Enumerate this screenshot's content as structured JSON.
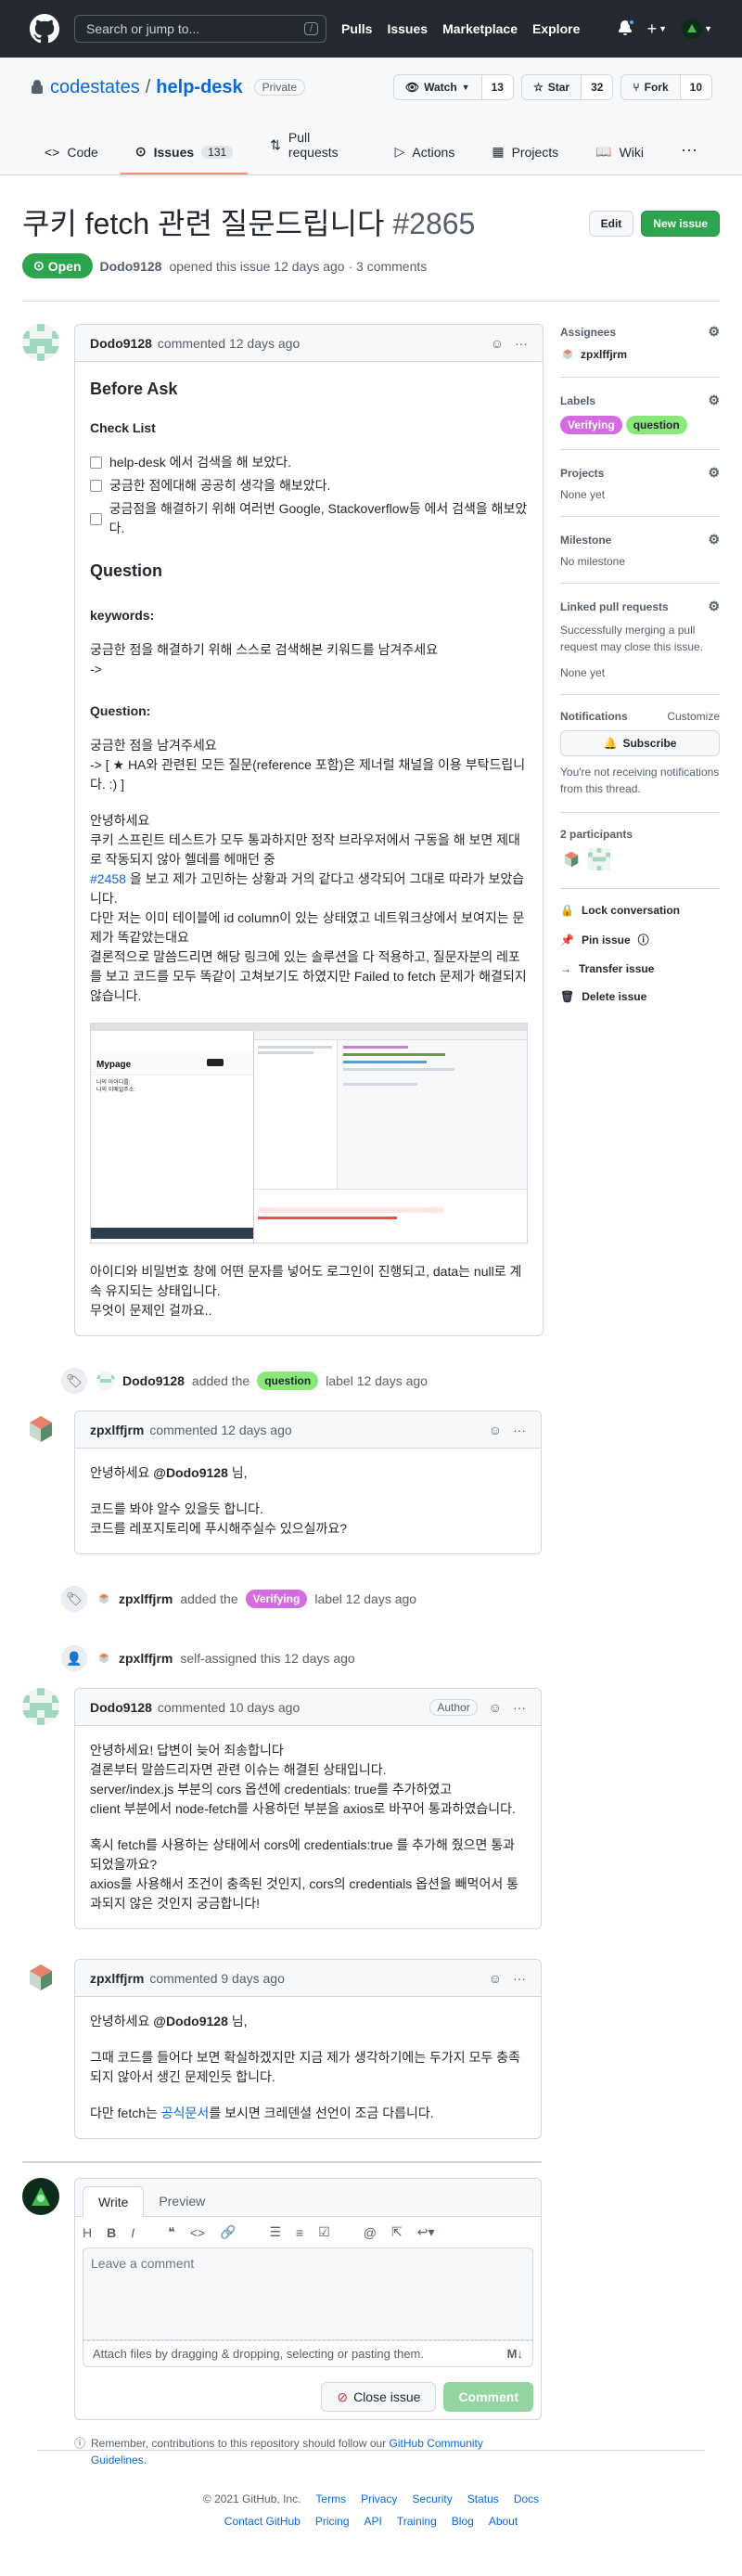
{
  "header": {
    "search_placeholder": "Search or jump to...",
    "search_shortcut": "/",
    "nav": [
      "Pulls",
      "Issues",
      "Marketplace",
      "Explore"
    ]
  },
  "repo": {
    "owner": "codestates",
    "separator": "/",
    "name": "help-desk",
    "visibility": "Private",
    "watch_label": "Watch",
    "watch_count": "13",
    "star_label": "Star",
    "star_count": "32",
    "fork_label": "Fork",
    "fork_count": "10",
    "tabs": [
      {
        "label": "Code"
      },
      {
        "label": "Issues",
        "count": "131"
      },
      {
        "label": "Pull requests"
      },
      {
        "label": "Actions"
      },
      {
        "label": "Projects"
      },
      {
        "label": "Wiki"
      }
    ]
  },
  "issue": {
    "title": "쿠키 fetch 관련 질문드립니다",
    "number": "#2865",
    "edit_label": "Edit",
    "new_issue_label": "New issue",
    "state": "Open",
    "author": "Dodo9128",
    "meta": "opened this issue 12 days ago · 3 comments"
  },
  "comment1": {
    "author": "Dodo9128",
    "time": "commented 12 days ago",
    "h1": "Before Ask",
    "checklist_title": "Check List",
    "checklist": [
      "help-desk 에서 검색을 해 보았다.",
      "궁금한 점에대해 공공히 생각을 해보았다.",
      "궁금점을 해결하기 위해 여러번 Google, Stackoverflow등 에서 검색을 해보았다."
    ],
    "h2": "Question",
    "keywords_title": "keywords:",
    "keywords_text1": "궁금한 점을 해결하기 위해 스스로 검색해본 키워드를 남겨주세요",
    "keywords_text2": "->",
    "question_title": "Question:",
    "q1": "궁금한 점을 남겨주세요",
    "q2": "-> [ ★ HA와 관련된 모든 질문(reference 포함)은 제너럴 채널을 이용 부탁드립니다. :) ]",
    "p1": "안녕하세요",
    "p2": "쿠키 스프린트 테스트가 모두 통과하지만 정작 브라우저에서 구동을 해 보면 제대로 작동되지 않아 헬데를 헤매던 중",
    "p3_link": "#2458",
    "p3_rest": " 을 보고 제가 고민하는 상황과 거의 같다고 생각되어 그대로 따라가 보았습니다.",
    "p4": "다만 저는 이미 테이블에 id column이 있는 상태였고 네트워크상에서 보여지는 문제가 똑같았는대요",
    "p5": "결론적으로 말씀드리면 해당 링크에 있는 솔루션을 다 적용하고, 질문자분의 레포를 보고 코드를 모두 똑같이 고쳐보기도 하였지만 Failed to fetch 문제가 해결되지 않습니다.",
    "shot_title": "Mypage",
    "shot_line1": "나의 아이디를:",
    "shot_line2": "나의 이메일주소:",
    "p6": "아이디와 비밀번호 창에 어떤 문자를 넣어도 로그인이 진행되고, data는 null로 계속 유지되는 상태입니다.",
    "p7": "무엇이 문제인 걸까요.."
  },
  "event1": {
    "author": "Dodo9128",
    "before": "added the",
    "label": "question",
    "after": "label 12 days ago"
  },
  "comment2": {
    "author": "zpxlffjrm",
    "time": "commented 12 days ago",
    "l1_pre": "안녕하세요 ",
    "l1_mention": "@Dodo9128",
    "l1_post": " 님,",
    "l2": "코드를 봐야 알수 있을듯 합니다.",
    "l3": "코드를 레포지토리에 푸시해주실수 있으실까요?"
  },
  "event2": {
    "author": "zpxlffjrm",
    "before": "added the",
    "label": "Verifying",
    "after": "label 12 days ago"
  },
  "event3": {
    "author": "zpxlffjrm",
    "text": "self-assigned this 12 days ago"
  },
  "comment3": {
    "author": "Dodo9128",
    "time": "commented 10 days ago",
    "badge": "Author",
    "l1": "안녕하세요! 답변이 늦어 죄송합니다",
    "l2": "결론부터 말씀드리자면 관련 이슈는 해결된 상태입니다.",
    "l3": "server/index.js 부분의 cors 옵션에 credentials: true를 추가하였고",
    "l4": "client 부분에서 node-fetch를 사용하던 부분을 axios로 바꾸어 통과하였습니다.",
    "l5": "혹시 fetch를 사용하는 상태에서 cors에 credentials:true 를 추가해 줬으면 통과되었을까요?",
    "l6": "axios를 사용해서 조건이 충족된 것인지, cors의 credentials 옵션을 빼먹어서 통과되지 않은 것인지 궁금합니다!"
  },
  "comment4": {
    "author": "zpxlffjrm",
    "time": "commented 9 days ago",
    "l1_pre": "안녕하세요 ",
    "l1_mention": "@Dodo9128",
    "l1_post": " 님,",
    "l2": "그때 코드를 들어다 보면 확실하겠지만 지금 제가 생각하기에는 두가지 모두 충족되지 않아서 생긴 문제인듯 합니다.",
    "l3_pre": "다만 fetch는 ",
    "l3_link": "공식문서",
    "l3_post": "를 보시면 크레덴셜 선언이 조금 다릅니다."
  },
  "composer": {
    "tab_write": "Write",
    "tab_preview": "Preview",
    "placeholder": "Leave a comment",
    "attach": "Attach files by dragging & dropping, selecting or pasting them.",
    "md": "M↓",
    "close_label": "Close issue",
    "comment_label": "Comment",
    "tip_text": "Remember, contributions to this repository should follow our ",
    "tip_link": "GitHub Community Guidelines",
    "tip_end": "."
  },
  "sidebar": {
    "assignees_title": "Assignees",
    "assignee": "zpxlffjrm",
    "labels_title": "Labels",
    "labels": [
      "Verifying",
      "question"
    ],
    "projects_title": "Projects",
    "projects_val": "None yet",
    "milestone_title": "Milestone",
    "milestone_val": "No milestone",
    "linked_title": "Linked pull requests",
    "linked_desc": "Successfully merging a pull request may close this issue.",
    "linked_val": "None yet",
    "notif_title": "Notifications",
    "notif_customize": "Customize",
    "subscribe": "Subscribe",
    "notif_desc": "You're not receiving notifications from this thread.",
    "participants_title": "2 participants",
    "lock": "Lock conversation",
    "pin": "Pin issue",
    "transfer": "Transfer issue",
    "delete": "Delete issue"
  },
  "footer": {
    "copyright": "© 2021 GitHub, Inc.",
    "row1": [
      "Terms",
      "Privacy",
      "Security",
      "Status",
      "Docs"
    ],
    "row2": [
      "Contact GitHub",
      "Pricing",
      "API",
      "Training",
      "Blog",
      "About"
    ]
  },
  "colors": {
    "accent": "#0969da",
    "open_green": "#2da44e",
    "header_bg": "#24292f"
  }
}
